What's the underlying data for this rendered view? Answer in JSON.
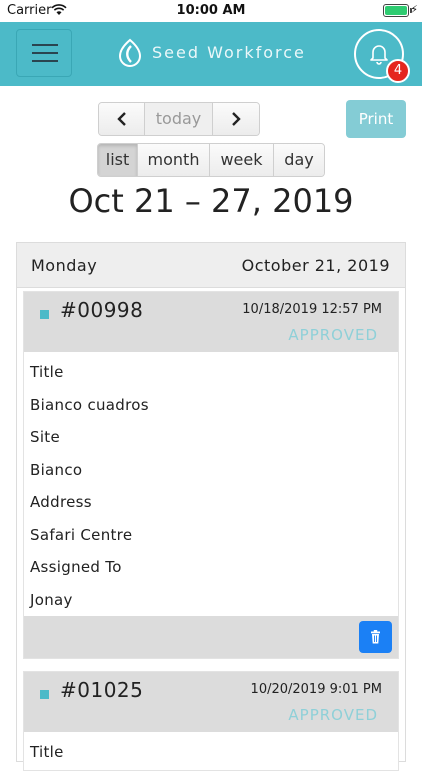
{
  "status_bar": {
    "carrier": "Carrier",
    "time": "10:00 AM"
  },
  "header": {
    "brand": "Seed Workforce",
    "notification_count": "4",
    "accent": "#4cbac8"
  },
  "toolbar": {
    "prev_icon": "‹",
    "today_label": "today",
    "next_icon": "›",
    "views": [
      "list",
      "month",
      "week",
      "day"
    ],
    "active_view": "list",
    "print_label": "Print"
  },
  "range_title": "Oct 21 – 27, 2019",
  "day": {
    "name": "Monday",
    "date": "October 21, 2019"
  },
  "jobs": [
    {
      "number": "#00998",
      "timestamp": "10/18/2019 12:57 PM",
      "status": "APPROVED",
      "fields": [
        {
          "label": "Title",
          "value": "Bianco cuadros"
        },
        {
          "label": "Site",
          "value": "Bianco"
        },
        {
          "label": "Address",
          "value": "Safari Centre"
        },
        {
          "label": "Assigned To",
          "value": "Jonay"
        }
      ]
    },
    {
      "number": "#01025",
      "timestamp": "10/20/2019 9:01 PM",
      "status": "APPROVED",
      "fields": [
        {
          "label": "Title",
          "value": ""
        }
      ]
    }
  ]
}
